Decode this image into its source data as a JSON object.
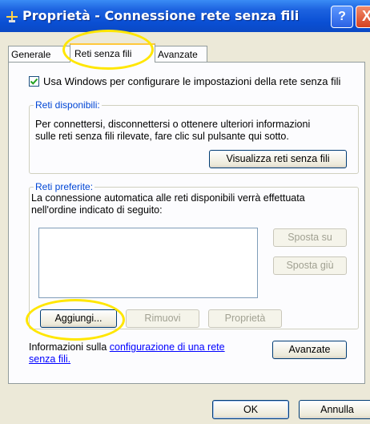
{
  "window": {
    "title": "Proprietà - Connessione rete senza fili",
    "help_label": "?",
    "close_label": "X"
  },
  "tabs": {
    "general": "Generale",
    "wireless": "Reti senza fili",
    "advanced": "Avanzate"
  },
  "checkbox": {
    "label": "Usa Windows per configurare le impostazioni della rete senza fili",
    "checked": true
  },
  "available": {
    "title": "Reti disponibili:",
    "line1": "Per connettersi, disconnettersi o ottenere ulteriori informazioni",
    "line2": "sulle reti senza fili rilevate, fare clic sul pulsante qui sotto.",
    "view_button": "Visualizza reti senza fili"
  },
  "preferred": {
    "title": "Reti preferite:",
    "line1": "La connessione automatica alle reti disponibili verrà effettuata",
    "line2": "nell'ordine indicato di seguito:",
    "move_up": "Sposta su",
    "move_down": "Sposta giù",
    "add": "Aggiungi...",
    "remove": "Rimuovi",
    "properties": "Proprietà"
  },
  "info": {
    "prefix": "Informazioni sulla ",
    "link1": "configurazione di una rete",
    "link2": "senza fili."
  },
  "advanced_button": "Avanzate",
  "footer": {
    "ok": "OK",
    "cancel": "Annulla"
  },
  "colors": {
    "title_bar": "#0a4fd4",
    "highlight": "#ffe600",
    "group_label": "#0046d5"
  }
}
